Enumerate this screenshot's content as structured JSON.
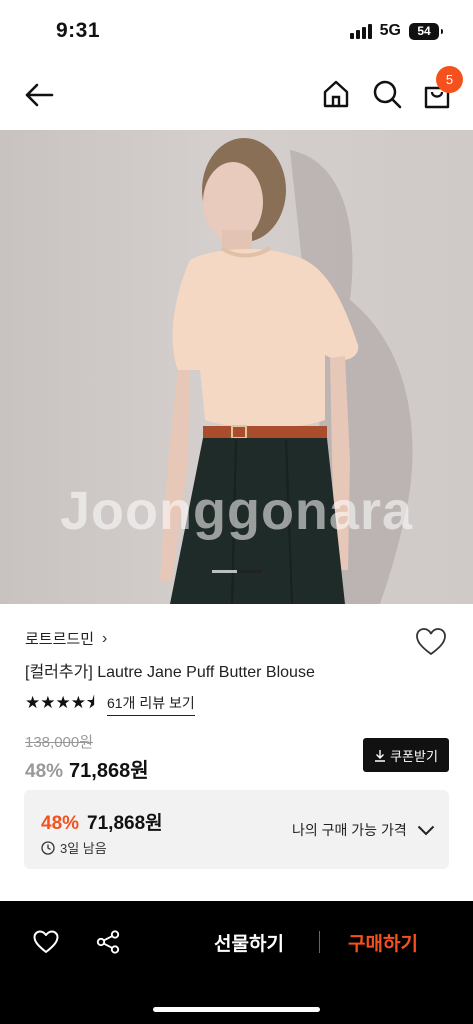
{
  "status_bar": {
    "time": "9:31",
    "network": "5G",
    "battery": "54"
  },
  "header": {
    "cart_count": "5"
  },
  "hero": {
    "watermark": "Joonggonara"
  },
  "product": {
    "brand": "로트르드민",
    "brand_chevron": "›",
    "title": "[컬러추가] Lautre Jane Puff Butter Blouse",
    "rating": 4.5,
    "stars": "★★★★⯨",
    "review_link": "61개 리뷰 보기",
    "original_price": "138,000원",
    "discount_pct": "48%",
    "sale_price": "71,868원",
    "coupon_label": "쿠폰받기"
  },
  "my_price": {
    "discount_pct": "48%",
    "price": "71,868원",
    "time_left": "3일 남음",
    "label": "나의 구매 가능 가격"
  },
  "bottom_bar": {
    "gift_label": "선물하기",
    "buy_label": "구매하기"
  },
  "colors": {
    "accent": "#f4511e",
    "bar_bg": "#000000",
    "box_bg": "#f2f2f2"
  }
}
